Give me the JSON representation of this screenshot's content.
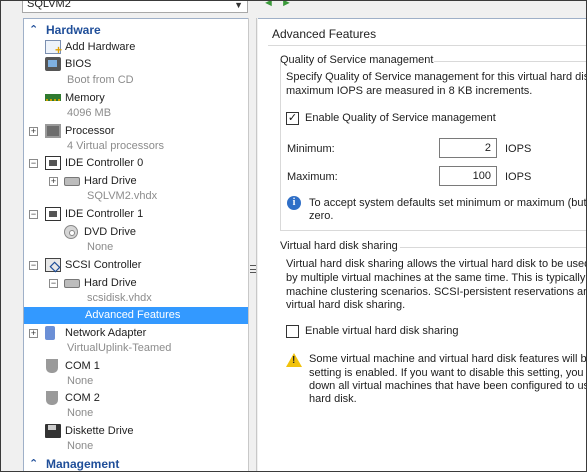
{
  "header": {
    "vm_name": "SQLVM2"
  },
  "sidebar": {
    "hardware_section": "Hardware",
    "management_section": "Management",
    "items": [
      {
        "label": "Add Hardware",
        "sub": ""
      },
      {
        "label": "BIOS",
        "sub": "Boot from CD"
      },
      {
        "label": "Memory",
        "sub": "4096 MB"
      },
      {
        "label": "Processor",
        "sub": "4 Virtual processors"
      },
      {
        "label": "IDE Controller 0",
        "sub": ""
      },
      {
        "label": "Hard Drive",
        "sub": "SQLVM2.vhdx"
      },
      {
        "label": "IDE Controller 1",
        "sub": ""
      },
      {
        "label": "DVD Drive",
        "sub": "None"
      },
      {
        "label": "SCSI Controller",
        "sub": ""
      },
      {
        "label": "Hard Drive",
        "sub": "scsidisk.vhdx"
      },
      {
        "label": "Advanced Features",
        "sub": ""
      },
      {
        "label": "Network Adapter",
        "sub": "VirtualUplink-Teamed"
      },
      {
        "label": "COM 1",
        "sub": "None"
      },
      {
        "label": "COM 2",
        "sub": "None"
      },
      {
        "label": "Diskette Drive",
        "sub": "None"
      }
    ],
    "selected": "Advanced Features"
  },
  "main": {
    "title": "Advanced Features",
    "qos": {
      "heading": "Quality of Service management",
      "desc_line1": "Specify Quality of Service management for this virtual hard disk",
      "desc_line2": "maximum IOPS are measured in 8 KB increments.",
      "enable_label": "Enable Quality of Service management",
      "enable_checked": true,
      "minimum_label": "Minimum:",
      "minimum_value": "2",
      "maximum_label": "Maximum:",
      "maximum_value": "100",
      "unit": "IOPS",
      "info_line1": "To accept system defaults set minimum or maximum (but r",
      "info_line2": "zero."
    },
    "sharing": {
      "heading": "Virtual hard disk sharing",
      "desc_line1": "Virtual hard disk sharing allows the virtual hard disk to be used",
      "desc_line2": "by multiple virtual machines at the same time. This is typically u",
      "desc_line3": "machine clustering scenarios. SCSI-persistent reservations are",
      "desc_line4": "virtual hard disk sharing.",
      "enable_label": "Enable virtual hard disk sharing",
      "enable_checked": false,
      "warn_line1": "Some virtual machine and virtual hard disk features will be",
      "warn_line2": "setting is enabled. If you want to disable this setting, you",
      "warn_line3": "down all virtual machines that have been configured to us",
      "warn_line4": "hard disk."
    }
  }
}
